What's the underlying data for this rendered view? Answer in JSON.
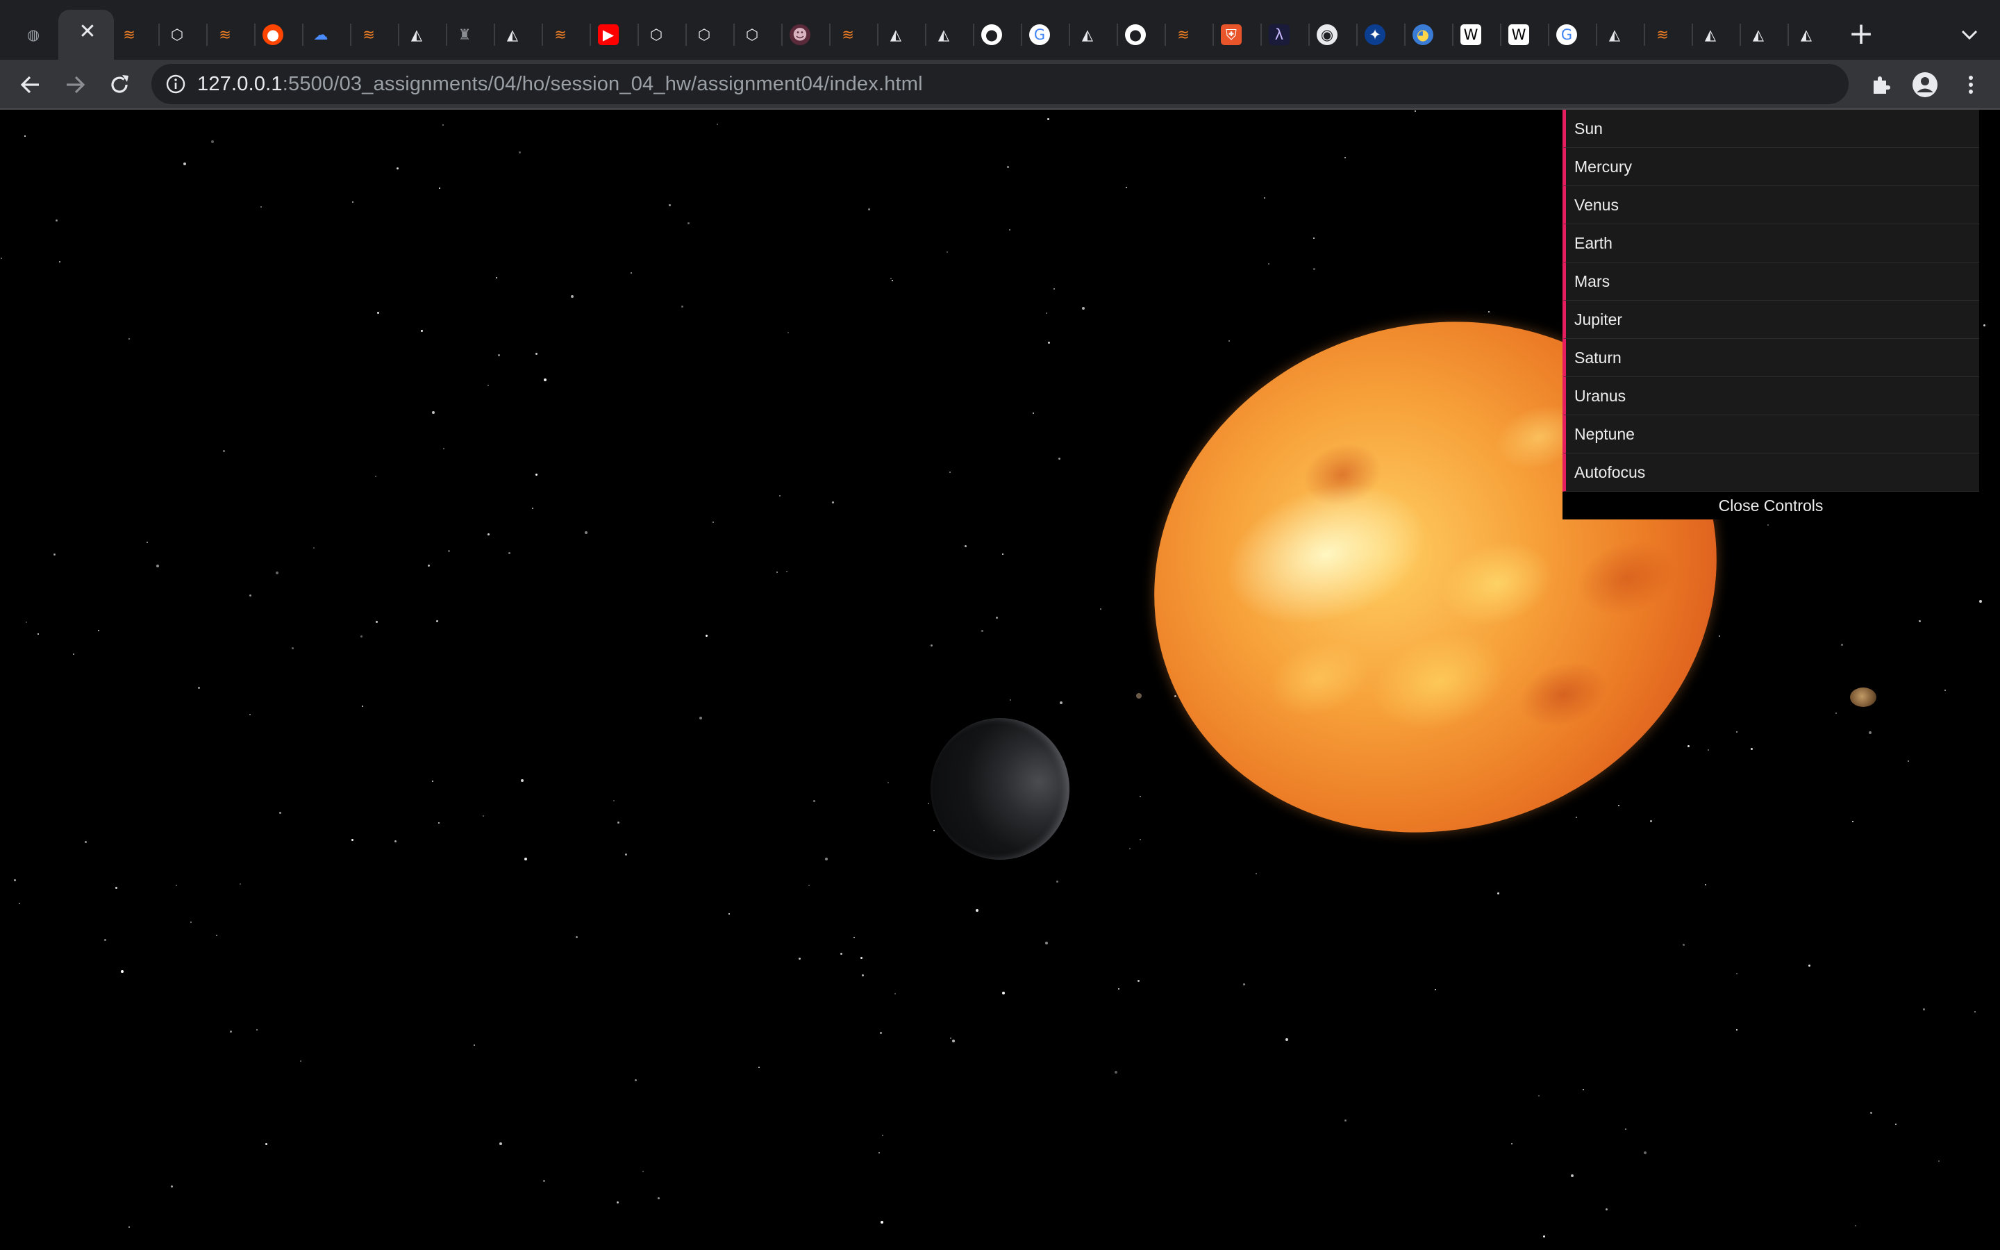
{
  "browser": {
    "url_host": "127.0.0.1",
    "url_rest": ":5500/03_assignments/04/ho/session_04_hw/assignment04/index.html",
    "tabs": [
      {
        "icon": "globe-icon"
      },
      {
        "icon": "close-icon",
        "active": true
      },
      {
        "icon": "stackoverflow-icon"
      },
      {
        "icon": "cube-icon"
      },
      {
        "icon": "stackoverflow-icon"
      },
      {
        "icon": "reddit-icon"
      },
      {
        "icon": "cloud-icon"
      },
      {
        "icon": "stackoverflow-icon"
      },
      {
        "icon": "threejs-icon"
      },
      {
        "icon": "figure-icon"
      },
      {
        "icon": "threejs-icon"
      },
      {
        "icon": "stackoverflow-icon"
      },
      {
        "icon": "youtube-icon"
      },
      {
        "icon": "cube-icon"
      },
      {
        "icon": "cube-icon"
      },
      {
        "icon": "cube-icon"
      },
      {
        "icon": "avatar-icon"
      },
      {
        "icon": "stackoverflow-icon"
      },
      {
        "icon": "threejs-icon"
      },
      {
        "icon": "threejs-icon"
      },
      {
        "icon": "github-icon"
      },
      {
        "icon": "google-icon"
      },
      {
        "icon": "threejs-icon"
      },
      {
        "icon": "github-icon"
      },
      {
        "icon": "stackoverflow-icon"
      },
      {
        "icon": "shield-icon"
      },
      {
        "icon": "code-icon"
      },
      {
        "icon": "eye-icon"
      },
      {
        "icon": "nasa-icon"
      },
      {
        "icon": "globe-app-icon"
      },
      {
        "icon": "wikipedia-icon"
      },
      {
        "icon": "wikipedia-icon"
      },
      {
        "icon": "google-icon"
      },
      {
        "icon": "threejs-icon"
      },
      {
        "icon": "stackoverflow-icon"
      },
      {
        "icon": "threejs-icon"
      },
      {
        "icon": "threejs-icon"
      },
      {
        "icon": "threejs-icon"
      }
    ],
    "toolbar_icons": [
      "back-arrow-icon",
      "forward-arrow-icon",
      "reload-icon",
      "info-icon",
      "share-icon",
      "bookmark-star-icon",
      "extensions-icon",
      "profile-icon",
      "menu-icon"
    ]
  },
  "controls": {
    "items": [
      {
        "label": "Sun"
      },
      {
        "label": "Mercury"
      },
      {
        "label": "Venus"
      },
      {
        "label": "Earth"
      },
      {
        "label": "Mars"
      },
      {
        "label": "Jupiter"
      },
      {
        "label": "Saturn"
      },
      {
        "label": "Uranus"
      },
      {
        "label": "Neptune"
      },
      {
        "label": "Autofocus"
      }
    ],
    "close_label": "Close Controls",
    "accent_color": "#e61d5f"
  },
  "colors": {
    "tabstrip": "#1f2023",
    "toolbar": "#35363a",
    "omnibox": "#202124",
    "scene_background": "#000000"
  }
}
